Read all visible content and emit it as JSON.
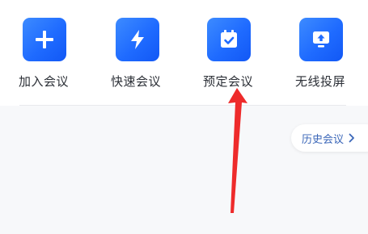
{
  "quick_actions": [
    {
      "label": "加入会议",
      "icon": "plus-icon"
    },
    {
      "label": "快速会议",
      "icon": "lightning-icon"
    },
    {
      "label": "预定会议",
      "icon": "calendar-check-icon"
    },
    {
      "label": "无线投屏",
      "icon": "screen-cast-icon"
    }
  ],
  "history": {
    "label": "历史会议",
    "icon": "chevron-right-icon"
  },
  "colors": {
    "tile_blue": "#1f6bff",
    "history_text": "#3a66b8",
    "annotation_arrow": "#ee2b2b"
  }
}
